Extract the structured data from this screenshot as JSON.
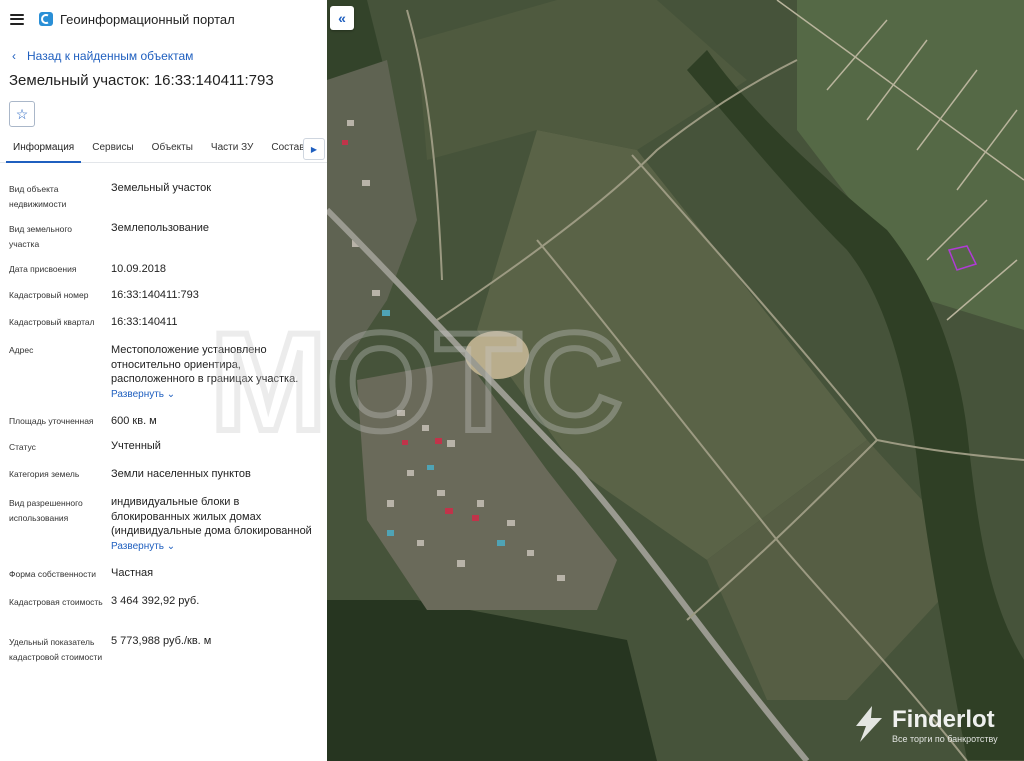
{
  "header": {
    "title": "Геоинформационный портал"
  },
  "nav": {
    "back_label": "Назад к найденным объектам"
  },
  "object": {
    "title": "Земельный участок: 16:33:140411:793"
  },
  "tabs": [
    "Информация",
    "Сервисы",
    "Объекты",
    "Части ЗУ",
    "Состав"
  ],
  "fields": [
    {
      "label": "Вид объекта недвижимости",
      "value": "Земельный участок"
    },
    {
      "label": "Вид земельного участка",
      "value": "Землепользование"
    },
    {
      "label": "Дата присвоения",
      "value": "10.09.2018"
    },
    {
      "label": "Кадастровый номер",
      "value": "16:33:140411:793"
    },
    {
      "label": "Кадастровый квартал",
      "value": "16:33:140411"
    },
    {
      "label": "Адрес",
      "value": "Местоположение установлено относительно ориентира, расположенного в границах участка.",
      "expand": "Развернуть"
    },
    {
      "label": "Площадь уточненная",
      "value": "600 кв. м"
    },
    {
      "label": "Статус",
      "value": "Учтенный"
    },
    {
      "label": "Категория земель",
      "value": "Земли населенных пунктов"
    },
    {
      "label": "Вид разрешенного использования",
      "value": "индивидуальные блоки в блокированных жилых домах (индивидуальные дома блокированной",
      "expand": "Развернуть"
    },
    {
      "label": "Форма собственности",
      "value": "Частная"
    },
    {
      "label": "Кадастровая стоимость",
      "value": "3 464 392,92 руб."
    },
    {
      "label": "Удельный показатель кадастровой стоимости",
      "value": "5 773,988 руб./кв. м"
    }
  ],
  "watermark": {
    "brand_name": "Finderlot",
    "brand_tagline": "Все торги по банкротству",
    "overlay_text": "MOTC"
  },
  "colors": {
    "accent": "#1f5fbf",
    "parcel_outline": "#b03bd6"
  }
}
